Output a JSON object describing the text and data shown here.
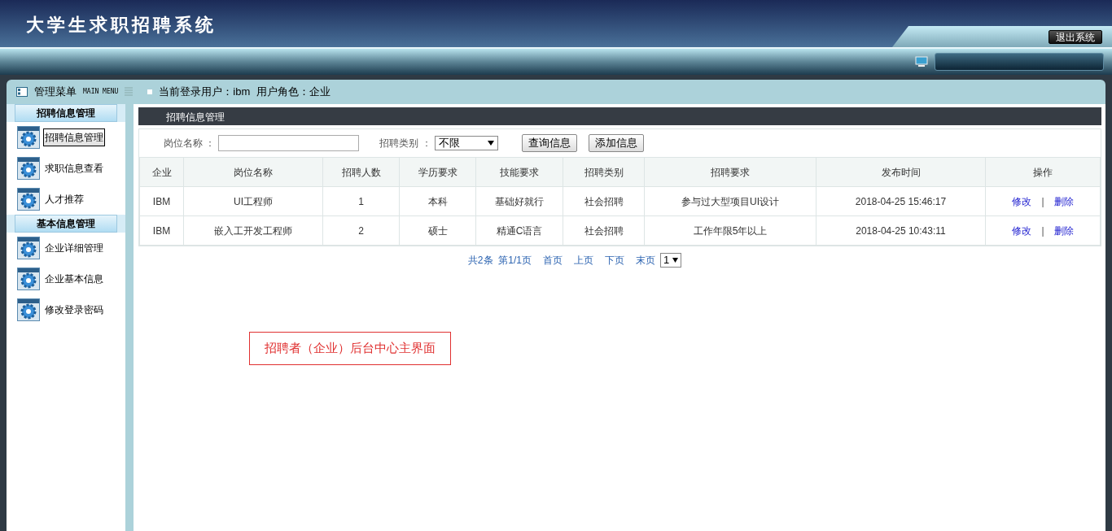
{
  "header": {
    "title": "大学生求职招聘系统",
    "logout_button": "退出系统"
  },
  "menu_bar": {
    "title": "管理菜单",
    "subtitle": "MAIN MENU",
    "user_info": "当前登录用户：ibm  用户角色：企业"
  },
  "sidebar": {
    "groups": [
      {
        "title": "招聘信息管理",
        "items": [
          {
            "label": "招聘信息管理",
            "selected": true
          },
          {
            "label": "求职信息查看",
            "selected": false
          },
          {
            "label": "人才推荐",
            "selected": false
          }
        ]
      },
      {
        "title": "基本信息管理",
        "items": [
          {
            "label": "企业详细管理",
            "selected": false
          },
          {
            "label": "企业基本信息",
            "selected": false
          },
          {
            "label": "修改登录密码",
            "selected": false
          }
        ]
      }
    ]
  },
  "panel": {
    "title": "招聘信息管理",
    "search": {
      "name_label": "岗位名称 ：",
      "type_label": "招聘类别 ：",
      "type_value": "不限",
      "query_button": "查询信息",
      "add_button": "添加信息"
    },
    "table": {
      "columns": [
        "企业",
        "岗位名称",
        "招聘人数",
        "学历要求",
        "技能要求",
        "招聘类别",
        "招聘要求",
        "发布时间",
        "操作"
      ],
      "rows": [
        {
          "cells": [
            "IBM",
            "UI工程师",
            "1",
            "本科",
            "基础好就行",
            "社会招聘",
            "参与过大型项目UI设计",
            "2018-04-25 15:46:17"
          ],
          "actions": [
            "修改",
            "|",
            "删除"
          ]
        },
        {
          "cells": [
            "IBM",
            "嵌入工开发工程师",
            "2",
            "硕士",
            "精通C语言",
            "社会招聘",
            "工作年限5年以上",
            "2018-04-25 10:43:11"
          ],
          "actions": [
            "修改",
            "|",
            "删除"
          ]
        }
      ]
    },
    "pagination": {
      "summary": "共2条  第1/1页",
      "links": [
        "首页",
        "上页",
        "下页",
        "末页"
      ],
      "page_value": "1"
    }
  },
  "annotation": "招聘者（企业）后台中心主界面"
}
